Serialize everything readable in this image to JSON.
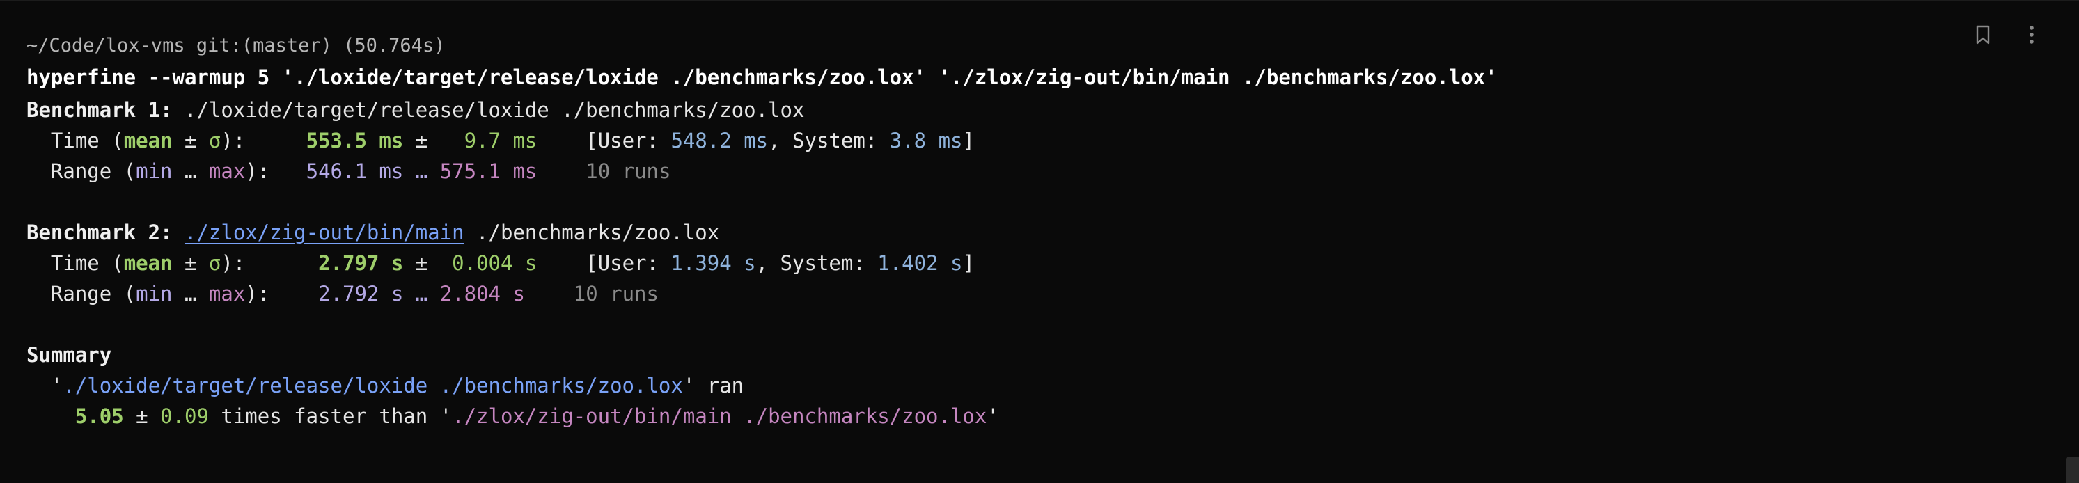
{
  "prompt": "~/Code/lox-vms git:(master) (50.764s)",
  "command": "hyperfine --warmup 5 './loxide/target/release/loxide ./benchmarks/zoo.lox' './zlox/zig-out/bin/main ./benchmarks/zoo.lox'",
  "bench1": {
    "label": "Benchmark 1:",
    "cmd": " ./loxide/target/release/loxide ./benchmarks/zoo.lox",
    "time": {
      "prefix": "  Time (",
      "mean": "mean",
      "pm": " ± ",
      "sigma": "σ",
      "suffix": "):     ",
      "mean_val": "553.5 ms",
      "pm2": " ±   ",
      "sigma_val": "9.7 ms",
      "gap": "    ",
      "user_open": "[User: ",
      "user_val": "548.2 ms",
      "sys_label": ", System: ",
      "sys_val": "3.8 ms",
      "close": "]"
    },
    "range": {
      "prefix": "  Range (",
      "min": "min",
      "dots": " … ",
      "max": "max",
      "suffix": "):   ",
      "min_val": "546.1 ms",
      "dots2": " … ",
      "max_val": "575.1 ms",
      "gap": "    ",
      "runs": "10 runs"
    }
  },
  "bench2": {
    "label": "Benchmark 2:",
    "cmd_sp": " ",
    "cmd_link": "./zlox/zig-out/bin/main",
    "cmd_rest": " ./benchmarks/zoo.lox",
    "time": {
      "prefix": "  Time (",
      "mean": "mean",
      "pm": " ± ",
      "sigma": "σ",
      "suffix": "):      ",
      "mean_val": "2.797 s",
      "pm2": " ±  ",
      "sigma_val": "0.004 s",
      "gap": "    ",
      "user_open": "[User: ",
      "user_val": "1.394 s",
      "sys_label": ", System: ",
      "sys_val": "1.402 s",
      "close": "]"
    },
    "range": {
      "prefix": "  Range (",
      "min": "min",
      "dots": " … ",
      "max": "max",
      "suffix": "):    ",
      "min_val": "2.792 s",
      "dots2": " … ",
      "max_val": "2.804 s",
      "gap": "    ",
      "runs": "10 runs"
    }
  },
  "summary": {
    "title": "Summary",
    "line1_indent": "  ",
    "q1": "'",
    "fastest_cmd": "./loxide/target/release/loxide ./benchmarks/zoo.lox",
    "q2": "'",
    "ran": " ran",
    "line2_indent": "    ",
    "ratio": "5.05",
    "pm": " ± ",
    "ratio_err": "0.09",
    "times_faster": " times faster than ",
    "q3": "'",
    "slower_cmd": "./zlox/zig-out/bin/main ./benchmarks/zoo.lox",
    "q4": "'"
  },
  "icons": {
    "bookmark": "bookmark-icon",
    "more": "more-vertical-icon"
  },
  "colors": {
    "background": "#0a0a0a",
    "green": "#9ece6a",
    "blue": "#7aa2f7",
    "purple": "#c586c0"
  }
}
